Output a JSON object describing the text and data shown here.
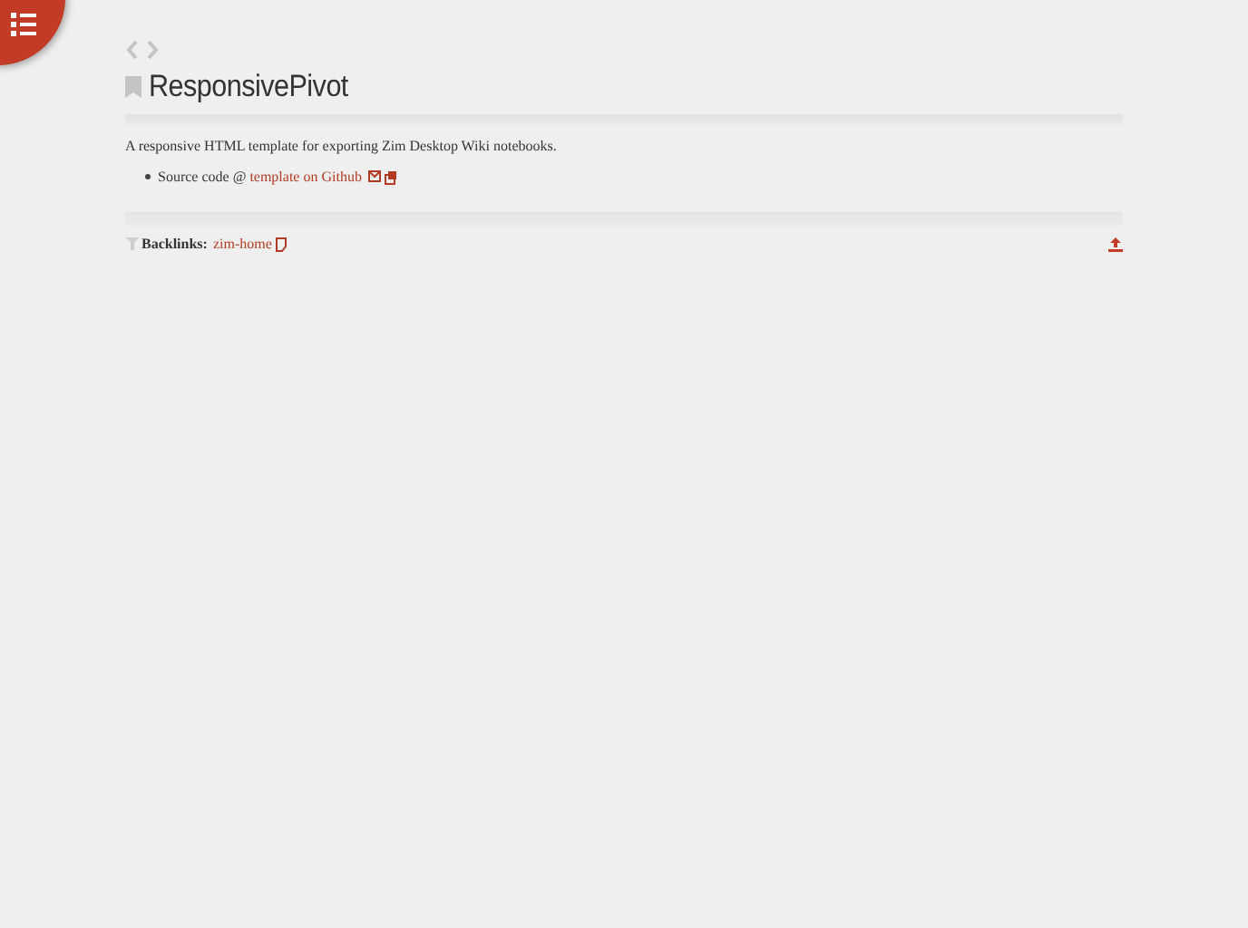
{
  "page": {
    "title": "ResponsivePivot",
    "description": "A responsive HTML template for exporting Zim Desktop Wiki notebooks.",
    "list_items": [
      {
        "text": "Source code @ ",
        "link": "template on Github"
      }
    ]
  },
  "footer": {
    "backlinks_label": "Backlinks:",
    "backlinks": [
      {
        "link": "zim-home"
      }
    ]
  }
}
